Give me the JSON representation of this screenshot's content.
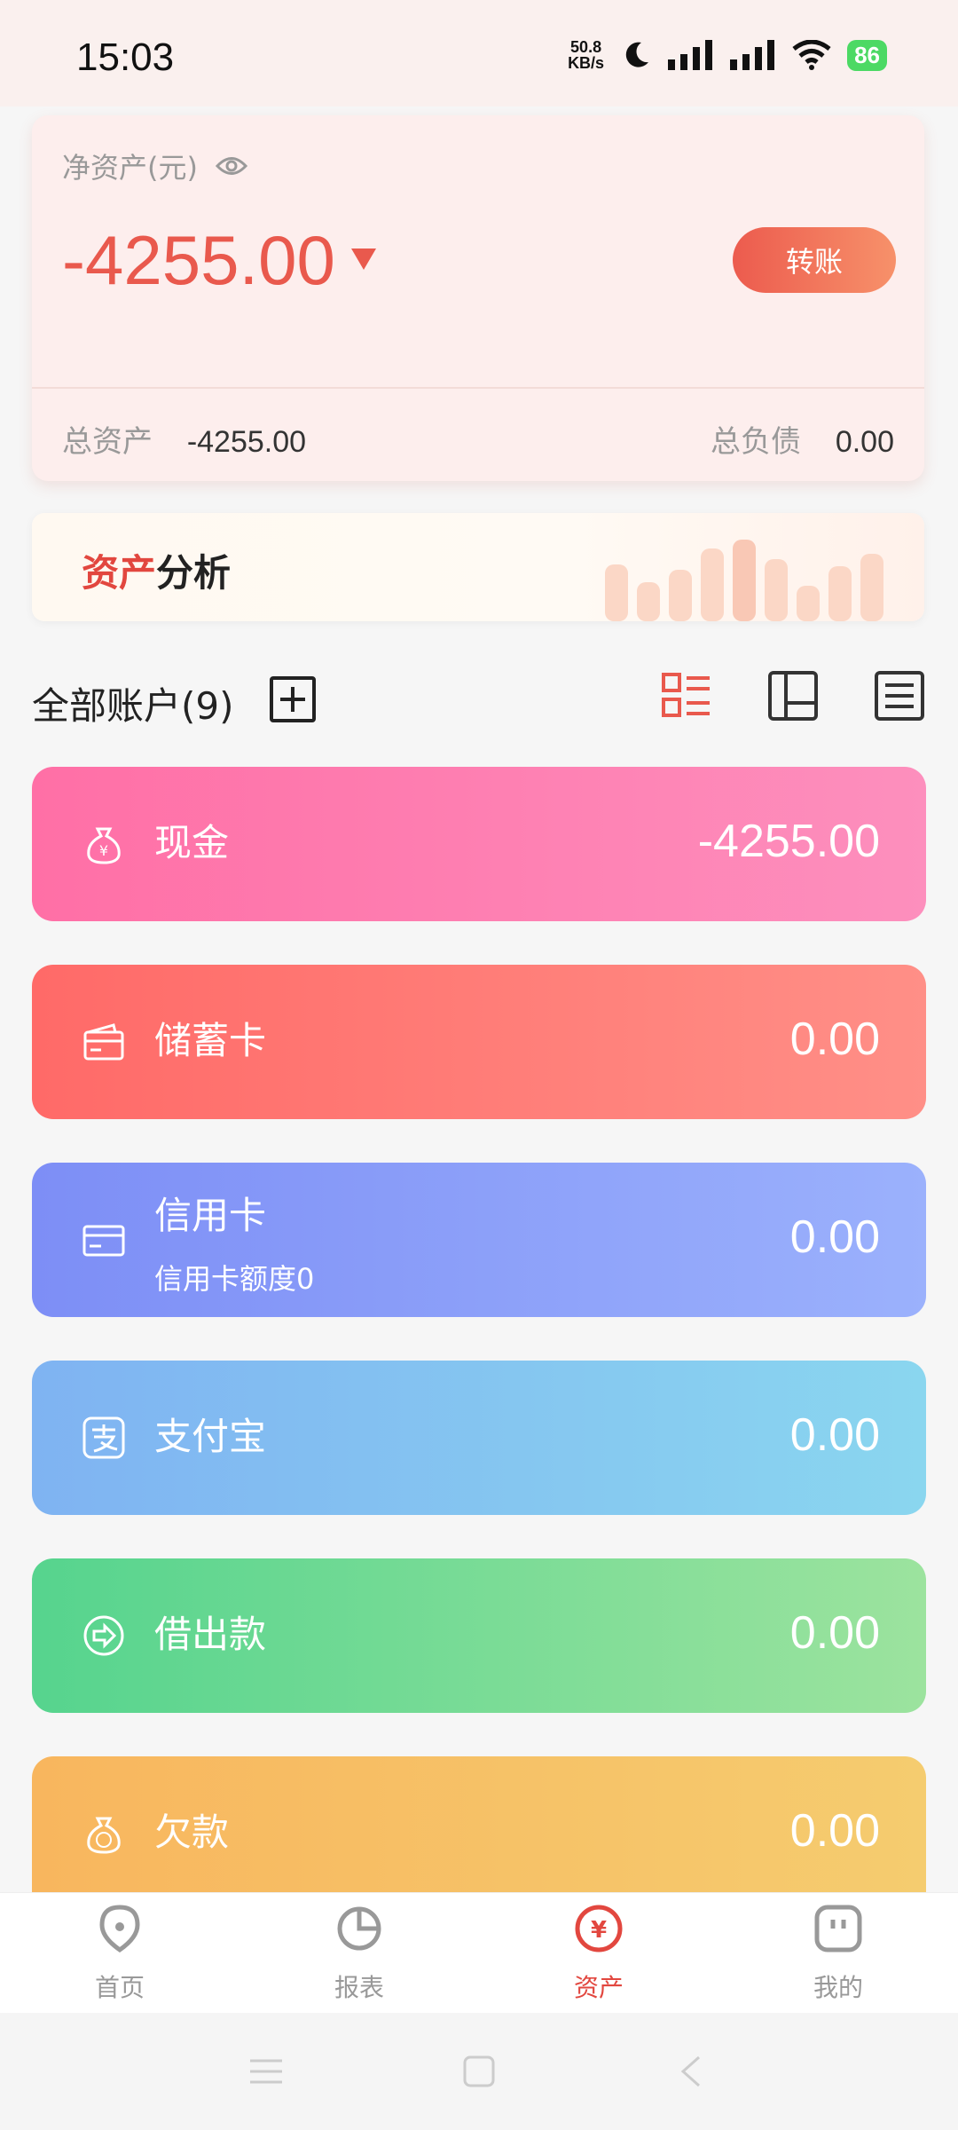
{
  "status": {
    "time": "15:03",
    "net_speed_top": "50.8",
    "net_speed_bottom": "KB/s",
    "battery": "86"
  },
  "summary": {
    "net_asset_label": "净资产(元)",
    "net_asset_value": "-4255.00",
    "transfer_label": "转账",
    "total_asset_label": "总资产",
    "total_asset_value": "-4255.00",
    "total_debt_label": "总负债",
    "total_debt_value": "0.00"
  },
  "analysis": {
    "title_red": "资产",
    "title_black": "分析"
  },
  "accounts_header": {
    "title": "全部账户(9)"
  },
  "accounts": [
    {
      "name": "现金",
      "amount": "-4255.00",
      "icon": "money-bag-yuan-icon",
      "color_from": "#ff6fa6",
      "color_to": "#fd8fbd"
    },
    {
      "name": "储蓄卡",
      "amount": "0.00",
      "icon": "wallet-card-icon",
      "color_from": "#ff6a68",
      "color_to": "#ff8f87"
    },
    {
      "name": "信用卡",
      "sub": "信用卡额度0",
      "amount": "0.00",
      "icon": "credit-card-icon",
      "color_from": "#7d8ef6",
      "color_to": "#9bb1fc"
    },
    {
      "name": "支付宝",
      "amount": "0.00",
      "icon": "alipay-icon",
      "color_from": "#7fb3f2",
      "color_to": "#8ad6ef"
    },
    {
      "name": "借出款",
      "amount": "0.00",
      "icon": "arrow-right-circle-icon",
      "color_from": "#56d48e",
      "color_to": "#9ce39e"
    },
    {
      "name": "欠款",
      "amount": "0.00",
      "icon": "money-bag-owe-icon",
      "color_from": "#f8b65e",
      "color_to": "#f5cc6f"
    }
  ],
  "nav": {
    "items": [
      {
        "label": "首页",
        "icon": "location-pin-icon"
      },
      {
        "label": "报表",
        "icon": "pie-chart-icon"
      },
      {
        "label": "资产",
        "icon": "yuan-coin-icon"
      },
      {
        "label": "我的",
        "icon": "profile-face-icon"
      }
    ],
    "active_color": "#e2473f",
    "inactive_color": "#999999"
  }
}
